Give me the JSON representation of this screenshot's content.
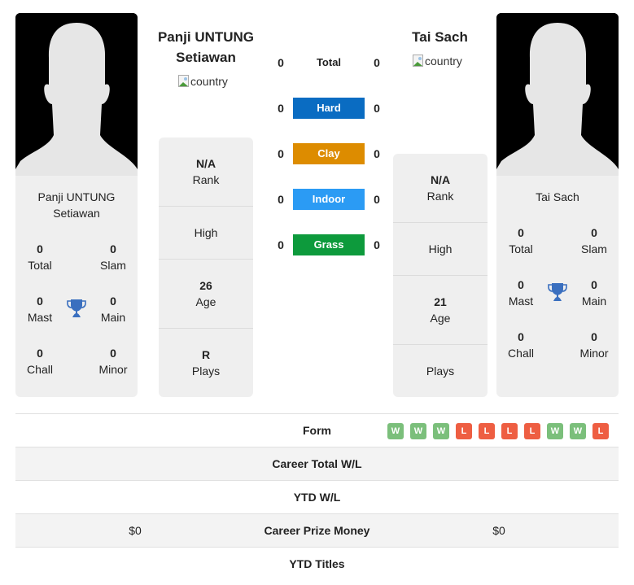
{
  "player1": {
    "name_line1": "Panji UNTUNG",
    "name_line2": "Setiawan",
    "card_name_line1": "Panji UNTUNG",
    "card_name_line2": "Setiawan",
    "country_alt": "country",
    "titles": {
      "total": {
        "value": "0",
        "label": "Total"
      },
      "slam": {
        "value": "0",
        "label": "Slam"
      },
      "mast": {
        "value": "0",
        "label": "Mast"
      },
      "main": {
        "value": "0",
        "label": "Main"
      },
      "chall": {
        "value": "0",
        "label": "Chall"
      },
      "minor": {
        "value": "0",
        "label": "Minor"
      }
    },
    "stats": {
      "rank": {
        "value": "N/A",
        "label": "Rank"
      },
      "high": {
        "value": "",
        "label": "High"
      },
      "age": {
        "value": "26",
        "label": "Age"
      },
      "plays": {
        "value": "R",
        "label": "Plays"
      }
    }
  },
  "player2": {
    "name": "Tai Sach",
    "card_name": "Tai Sach",
    "country_alt": "country",
    "titles": {
      "total": {
        "value": "0",
        "label": "Total"
      },
      "slam": {
        "value": "0",
        "label": "Slam"
      },
      "mast": {
        "value": "0",
        "label": "Mast"
      },
      "main": {
        "value": "0",
        "label": "Main"
      },
      "chall": {
        "value": "0",
        "label": "Chall"
      },
      "minor": {
        "value": "0",
        "label": "Minor"
      }
    },
    "stats": {
      "rank": {
        "value": "N/A",
        "label": "Rank"
      },
      "high": {
        "value": "",
        "label": "High"
      },
      "age": {
        "value": "21",
        "label": "Age"
      },
      "plays": {
        "value": "",
        "label": "Plays"
      }
    }
  },
  "surfaces": [
    {
      "label": "Total",
      "p1": "0",
      "p2": "0",
      "color": null
    },
    {
      "label": "Hard",
      "p1": "0",
      "p2": "0",
      "color": "#0a6cc2"
    },
    {
      "label": "Clay",
      "p1": "0",
      "p2": "0",
      "color": "#dd8c00"
    },
    {
      "label": "Indoor",
      "p1": "0",
      "p2": "0",
      "color": "#2b9bf4"
    },
    {
      "label": "Grass",
      "p1": "0",
      "p2": "0",
      "color": "#0d9a3c"
    }
  ],
  "comparison": {
    "form_label": "Form",
    "form": [
      "W",
      "W",
      "W",
      "L",
      "L",
      "L",
      "L",
      "W",
      "W",
      "L"
    ],
    "rows": [
      {
        "label": "Career Total W/L",
        "p1": "",
        "p2": ""
      },
      {
        "label": "YTD W/L",
        "p1": "",
        "p2": ""
      },
      {
        "label": "Career Prize Money",
        "p1": "$0",
        "p2": "$0"
      },
      {
        "label": "YTD Titles",
        "p1": "",
        "p2": ""
      }
    ]
  },
  "colors": {
    "trophy": "#3a6fbf",
    "win": "#7bbf7b",
    "loss": "#ee5e42"
  }
}
